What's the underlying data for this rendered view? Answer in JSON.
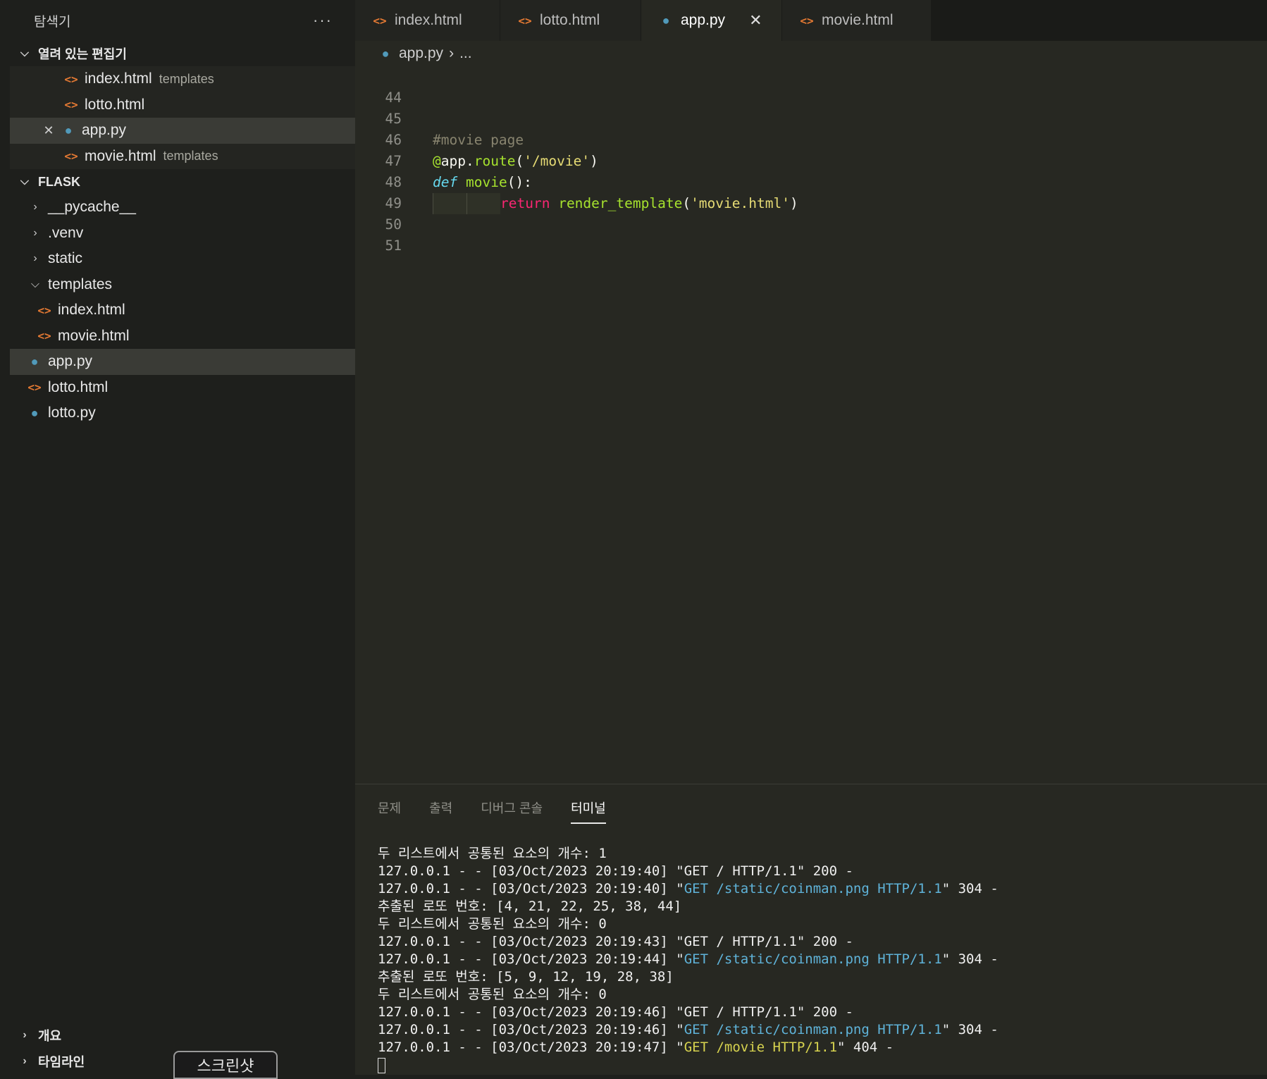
{
  "sidebar": {
    "title": "탐색기",
    "more": "···",
    "open_editors": {
      "label": "열려 있는 편집기",
      "items": [
        {
          "name": "index.html",
          "desc": "templates"
        },
        {
          "name": "lotto.html",
          "desc": ""
        },
        {
          "name": "app.py",
          "desc": ""
        },
        {
          "name": "movie.html",
          "desc": "templates"
        }
      ]
    },
    "folder": {
      "label": "FLASK",
      "items": [
        "__pycache__",
        ".venv",
        "static",
        "templates",
        "index.html",
        "movie.html",
        "app.py",
        "lotto.html",
        "lotto.py"
      ]
    },
    "outline_label": "개요",
    "timeline_label": "타임라인",
    "screenshot_label": "스크린샷"
  },
  "tabs": [
    {
      "label": "index.html"
    },
    {
      "label": "lotto.html"
    },
    {
      "label": "app.py"
    },
    {
      "label": "movie.html"
    }
  ],
  "breadcrumb": {
    "file": "app.py",
    "rest": "..."
  },
  "editor": {
    "line_numbers": [
      "44",
      "45",
      "46",
      "47",
      "48",
      "49",
      "50",
      "51"
    ],
    "comment": "#movie page",
    "deco_at": "@",
    "deco_app": "app",
    "deco_dot": ".",
    "deco_route": "route",
    "deco_open": "(",
    "deco_arg": "'/movie'",
    "deco_close": ")",
    "def_kw": "def",
    "def_name": "movie",
    "def_rest": "():",
    "return_kw": "return",
    "return_fn": "render_template",
    "return_open": "(",
    "return_arg": "'movie.html'",
    "return_close": ")"
  },
  "panel": {
    "tabs": [
      "문제",
      "출력",
      "디버그 콘솔",
      "터미널"
    ],
    "terminal": {
      "l1": "두 리스트에서 공통된 요소의 개수: 1",
      "l2a": "127.0.0.1 - - [03/Oct/2023 20:19:40] \"GET / HTTP/1.1\" 200 -",
      "l3a": "127.0.0.1 - - [03/Oct/2023 20:19:40] \"",
      "l3b": "GET /static/coinman.png HTTP/1.1",
      "l3c": "\" 304 -",
      "l4": "추출된 로또 번호: [4, 21, 22, 25, 38, 44]",
      "l5": "두 리스트에서 공통된 요소의 개수: 0",
      "l6": "127.0.0.1 - - [03/Oct/2023 20:19:43] \"GET / HTTP/1.1\" 200 -",
      "l7a": "127.0.0.1 - - [03/Oct/2023 20:19:44] \"",
      "l7b": "GET /static/coinman.png HTTP/1.1",
      "l7c": "\" 304 -",
      "l8": "추출된 로또 번호: [5, 9, 12, 19, 28, 38]",
      "l9": "두 리스트에서 공통된 요소의 개수: 0",
      "l10": "127.0.0.1 - - [03/Oct/2023 20:19:46] \"GET / HTTP/1.1\" 200 -",
      "l11a": "127.0.0.1 - - [03/Oct/2023 20:19:46] \"",
      "l11b": "GET /static/coinman.png HTTP/1.1",
      "l11c": "\" 304 -",
      "l12a": "127.0.0.1 - - [03/Oct/2023 20:19:47] \"",
      "l12b": "GET /movie HTTP/1.1",
      "l12c": "\" 404 -"
    }
  },
  "colors": {
    "html_icon": "#e37933",
    "py_icon": "#519aba",
    "background": "#272822"
  },
  "icons": {
    "html": "code-brackets-icon",
    "py": "python-icon",
    "close": "close-icon",
    "chevron_right": "chevron-right-icon",
    "chevron_down": "chevron-down-icon"
  }
}
